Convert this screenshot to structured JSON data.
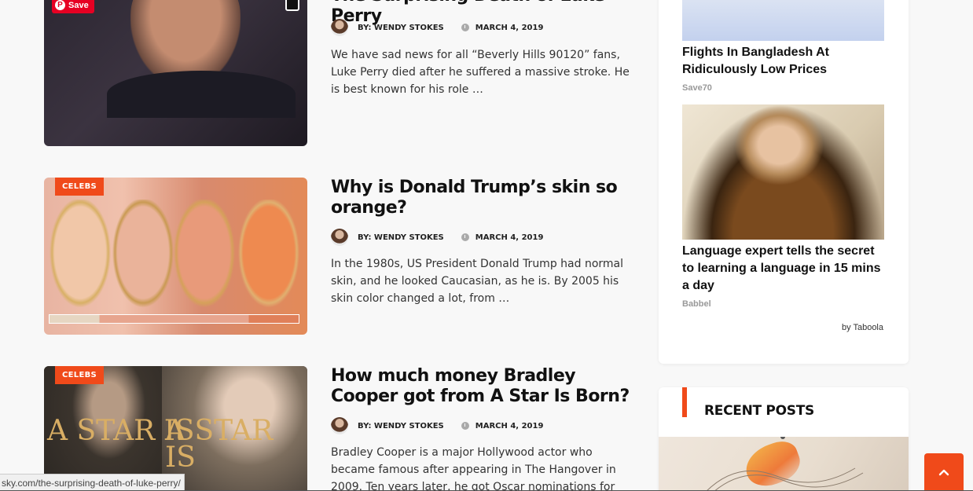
{
  "posts": [
    {
      "badge": "",
      "title": "The Surprising Death of Luke Perry",
      "author": "BY: WENDY STOKES",
      "date": "MARCH 4, 2019",
      "excerpt": "We have sad news for all “Beverly Hills 90120” fans, Luke Perry died after he suffered a massive stroke. He is best known for his role …",
      "pin_label": "Save"
    },
    {
      "badge": "CELEBS",
      "title": "Why is Donald Trump’s skin so orange?",
      "author": "BY: WENDY STOKES",
      "date": "MARCH 4, 2019",
      "excerpt": "In the 1980s, US President Donald Trump had normal skin, and he looked Caucasian, as he is. By 2005 his skin color changed a lot, from …"
    },
    {
      "badge": "CELEBS",
      "title": "How much money Bradley Cooper got from A Star Is Born?",
      "author": "BY: WENDY STOKES",
      "date": "MARCH 4, 2019",
      "excerpt": "Bradley Cooper is a major Hollywood actor who became famous after appearing in The Hangover in 2009. Ten years later, he got Oscar nominations for his …",
      "poster_text_left": "A STAR IS",
      "poster_text_right": "A STAR IS"
    }
  ],
  "sidebar": {
    "ads": [
      {
        "title": "Flights In Bangladesh At Ridiculously Low Prices",
        "source": "Save70"
      },
      {
        "title": "Language expert tells the secret to learning a language in 15 mins a day",
        "source": "Babbel"
      }
    ],
    "by_taboola": "by Taboola",
    "recent_posts_heading": "RECENT POSTS"
  },
  "status_url": "sky.com/the-surprising-death-of-luke-perry/",
  "colors": {
    "accent": "#f04a1a",
    "pinterest": "#e60023"
  }
}
